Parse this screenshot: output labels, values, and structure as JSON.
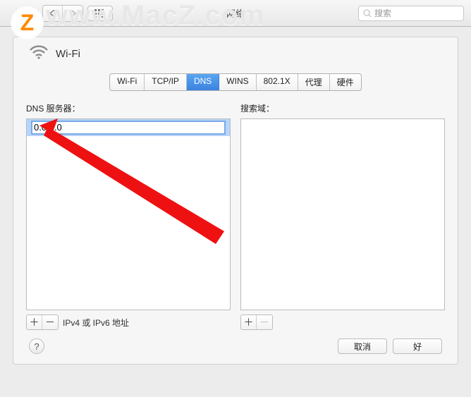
{
  "toolbar": {
    "window_title": "网络",
    "search_placeholder": "搜索"
  },
  "logo": {
    "letter": "Z"
  },
  "watermark": {
    "text": "www.MacZ.com"
  },
  "panel": {
    "wifi_label": "Wi-Fi"
  },
  "tabs": {
    "t0": "Wi-Fi",
    "t1": "TCP/IP",
    "t2": "DNS",
    "t3": "WINS",
    "t4": "802.1X",
    "t5": "代理",
    "t6": "硬件"
  },
  "left": {
    "label": "DNS 服务器：",
    "entry": "0.0.0.0",
    "hint": "IPv4 或 IPv6 地址"
  },
  "right": {
    "label": "搜索域："
  },
  "buttons": {
    "plus": "＋",
    "minus": "－",
    "help": "?",
    "cancel": "取消",
    "ok": "好"
  }
}
